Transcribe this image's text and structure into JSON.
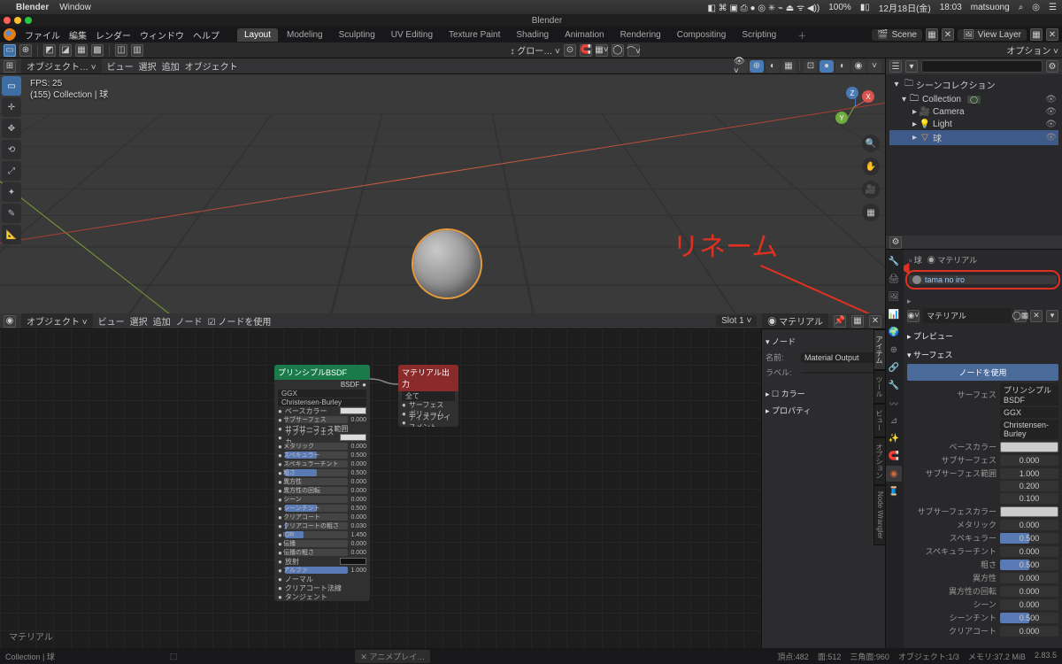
{
  "mac": {
    "app": "Blender",
    "menus": [
      "Window"
    ],
    "status": [
      "100%",
      "12月18日(金)",
      "18:03",
      "matsuong"
    ]
  },
  "window": {
    "title": "Blender"
  },
  "topmenu": {
    "items": [
      "ファイル",
      "編集",
      "レンダー",
      "ウィンドウ",
      "ヘルプ"
    ],
    "tabs": [
      "Layout",
      "Modeling",
      "Sculpting",
      "UV Editing",
      "Texture Paint",
      "Shading",
      "Animation",
      "Rendering",
      "Compositing",
      "Scripting"
    ],
    "active_tab": "Layout",
    "scene_label": "Scene",
    "layer_label": "View Layer"
  },
  "tool2": {
    "snap_label": "グロー…",
    "options_label": "オプション"
  },
  "viewport_header": {
    "mode": "オブジェクト…",
    "menus": [
      "ビュー",
      "選択",
      "追加",
      "オブジェクト"
    ]
  },
  "viewport_info": {
    "fps": "FPS: 25",
    "path": "(155) Collection | 球"
  },
  "annotation": {
    "text": "リネーム"
  },
  "node_header": {
    "mode": "オブジェクト",
    "menus": [
      "ビュー",
      "選択",
      "追加",
      "ノード"
    ],
    "use_nodes": "ノードを使用",
    "slot": "Slot 1",
    "material": "マテリアル"
  },
  "nodes": {
    "bsdf": {
      "title": "プリンシプルBSDF",
      "out": "BSDF",
      "dist": "GGX",
      "sss": "Christensen-Burley",
      "rows": [
        {
          "label": "ベースカラー",
          "type": "swatch"
        },
        {
          "label": "サブサーフェス",
          "type": "slider",
          "val": "0.000",
          "f": 0
        },
        {
          "label": "サブサーフェス範囲",
          "type": "text"
        },
        {
          "label": "サブサーフェスカ…",
          "type": "swatch"
        },
        {
          "label": "メタリック",
          "type": "slider",
          "val": "0.000",
          "f": 0
        },
        {
          "label": "スペキュラー",
          "type": "slider",
          "val": "0.500",
          "f": 50
        },
        {
          "label": "スペキュラーチント",
          "type": "slider",
          "val": "0.000",
          "f": 0
        },
        {
          "label": "粗さ",
          "type": "slider",
          "val": "0.500",
          "f": 50
        },
        {
          "label": "異方性",
          "type": "slider",
          "val": "0.000",
          "f": 0
        },
        {
          "label": "異方性の回転",
          "type": "slider",
          "val": "0.000",
          "f": 0
        },
        {
          "label": "シーン",
          "type": "slider",
          "val": "0.000",
          "f": 0
        },
        {
          "label": "シーンチント",
          "type": "slider",
          "val": "0.500",
          "f": 50
        },
        {
          "label": "クリアコート",
          "type": "slider",
          "val": "0.000",
          "f": 0
        },
        {
          "label": "クリアコートの粗さ",
          "type": "slider",
          "val": "0.030",
          "f": 3
        },
        {
          "label": "IOR",
          "type": "slider",
          "val": "1.450",
          "f": 30
        },
        {
          "label": "伝播",
          "type": "slider",
          "val": "0.000",
          "f": 0
        },
        {
          "label": "伝播の粗さ",
          "type": "slider",
          "val": "0.000",
          "f": 0
        },
        {
          "label": "放射",
          "type": "swatch",
          "dark": true
        },
        {
          "label": "アルファ",
          "type": "slider",
          "val": "1.000",
          "f": 100
        },
        {
          "label": "ノーマル",
          "type": "text"
        },
        {
          "label": "クリアコート法線",
          "type": "text"
        },
        {
          "label": "タンジェント",
          "type": "text"
        }
      ]
    },
    "out": {
      "title": "マテリアル出力",
      "all": "全て",
      "rows": [
        "サーフェス",
        "ボリューム",
        "ディスプレイスメント"
      ]
    },
    "breadcrumb": "マテリアル"
  },
  "node_side": {
    "tabs_vert": [
      "アイテム",
      "ツール",
      "ビュー",
      "オプション",
      "Node Wrangler"
    ],
    "node_h": "ノード",
    "name_l": "名前:",
    "name_v": "Material Output",
    "label_l": "ラベル:",
    "color_h": "カラー",
    "prop_h": "プロパティ"
  },
  "outliner": {
    "search_ph": "",
    "root": "シーンコレクション",
    "items": [
      {
        "icon": "col",
        "name": "Collection",
        "tag": "◯"
      },
      {
        "icon": "cam",
        "name": "Camera"
      },
      {
        "icon": "light",
        "name": "Light"
      },
      {
        "icon": "mesh",
        "name": "球",
        "sel": true
      }
    ]
  },
  "props": {
    "breadcrumb": {
      "obj": "球",
      "mat": "マテリアル"
    },
    "slot_name": "tama no iro",
    "material_dd": "マテリアル",
    "preview": "プレビュー",
    "surface": "サーフェス",
    "use_nodes_btn": "ノードを使用",
    "surface_dd_l": "サーフェス",
    "surface_dd": "プリンシプルBSDF",
    "dist": "GGX",
    "sss": "Christensen-Burley",
    "fields": [
      {
        "l": "ベースカラー",
        "type": "swatch"
      },
      {
        "l": "サブサーフェス",
        "v": "0.000",
        "f": 0
      },
      {
        "l": "サブサーフェス範囲",
        "v": "1.000",
        "f": 0,
        "plain": true
      },
      {
        "l": "",
        "v": "0.200",
        "f": 0,
        "plain": true
      },
      {
        "l": "",
        "v": "0.100",
        "f": 0,
        "plain": true
      },
      {
        "l": "サブサーフェスカラー",
        "type": "swatch"
      },
      {
        "l": "メタリック",
        "v": "0.000",
        "f": 0
      },
      {
        "l": "スペキュラー",
        "v": "0.500",
        "f": 50
      },
      {
        "l": "スペキュラーチント",
        "v": "0.000",
        "f": 0
      },
      {
        "l": "粗さ",
        "v": "0.500",
        "f": 50
      },
      {
        "l": "異方性",
        "v": "0.000",
        "f": 0
      },
      {
        "l": "異方性の回転",
        "v": "0.000",
        "f": 0
      },
      {
        "l": "シーン",
        "v": "0.000",
        "f": 0
      },
      {
        "l": "シーンチント",
        "v": "0.500",
        "f": 50
      },
      {
        "l": "クリアコート",
        "v": "0.000",
        "f": 0
      }
    ]
  },
  "status": {
    "left": "Collection | 球",
    "play": "アニメプレイ…",
    "right": [
      "頂点:482",
      "面:512",
      "三角面:960",
      "オブジェクト:1/3",
      "メモリ:37.2 MiB",
      "2.83.5"
    ]
  }
}
